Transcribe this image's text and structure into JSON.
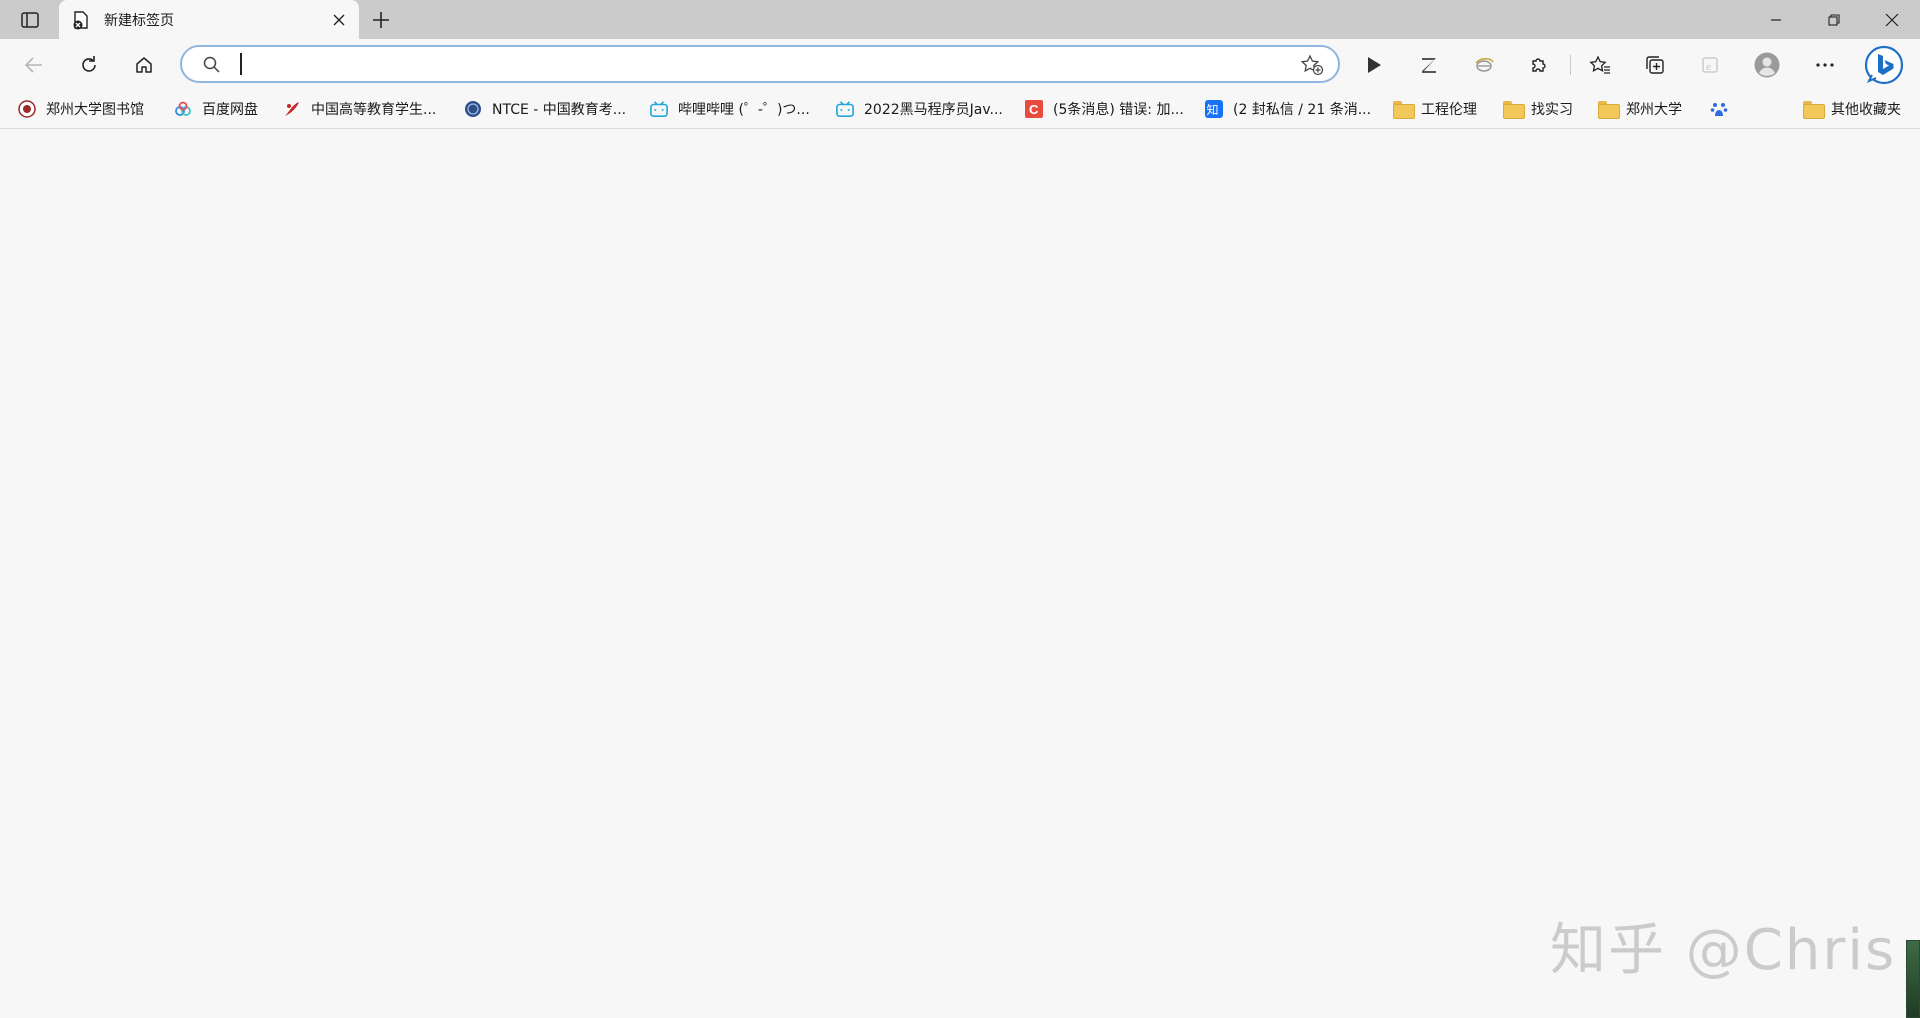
{
  "tab": {
    "title": "新建标签页"
  },
  "address": {
    "value": "",
    "placeholder": ""
  },
  "bookmarks": [
    {
      "label": "郑州大学图书馆",
      "icon": "zzu-library-icon"
    },
    {
      "label": "百度网盘",
      "icon": "baidu-netdisk-icon"
    },
    {
      "label": "中国高等教育学生...",
      "icon": "chsi-icon"
    },
    {
      "label": "NTCE - 中国教育考...",
      "icon": "ntce-icon"
    },
    {
      "label": "哔哩哔哩 (゜-゜)つ...",
      "icon": "bilibili-icon"
    },
    {
      "label": "2022黑马程序员Jav...",
      "icon": "bilibili-icon"
    },
    {
      "label": "(5条消息) 错误: 加...",
      "icon": "csdn-icon"
    },
    {
      "label": "(2 封私信 / 21 条消...",
      "icon": "zhihu-icon"
    },
    {
      "label": "工程伦理",
      "icon": "folder-icon"
    },
    {
      "label": "找实习",
      "icon": "folder-icon"
    },
    {
      "label": "郑州大学",
      "icon": "folder-icon"
    },
    {
      "label": "",
      "icon": "baidu-paw-icon"
    },
    {
      "label": "其他收藏夹",
      "icon": "folder-icon"
    }
  ],
  "watermark": "知乎 @Chris",
  "colors": {
    "tabstrip": "#cbcbcb",
    "page": "#f7f7f7",
    "address_border": "#8fb6dc",
    "bing": "#1f6fc6"
  }
}
